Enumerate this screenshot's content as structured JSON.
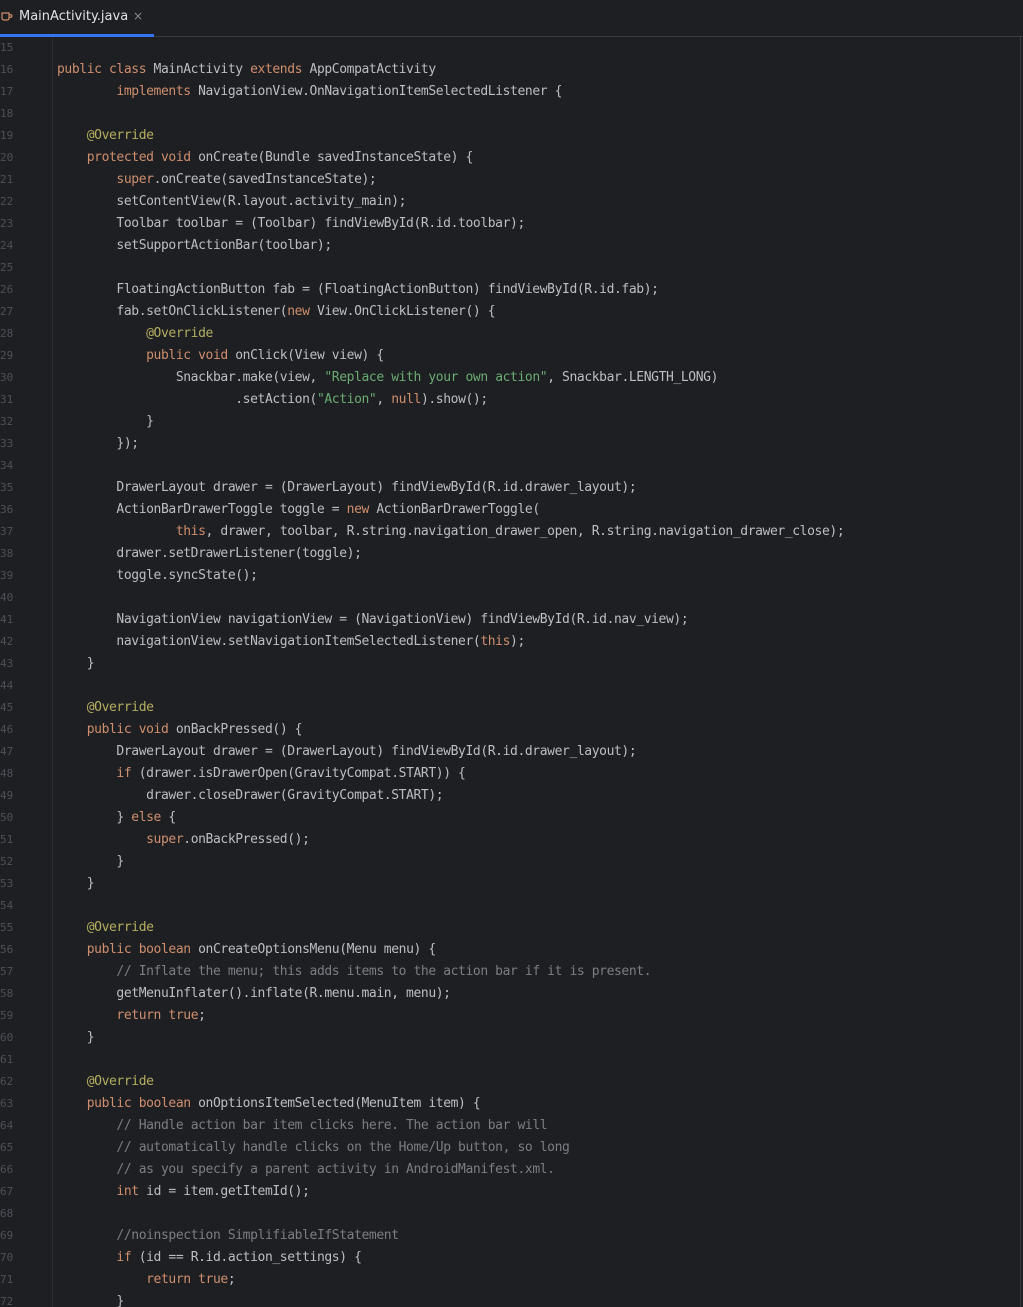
{
  "theme": {
    "background": "#1e1f22",
    "accent": "#3574f0",
    "keyword": "#cf8e6d",
    "annotation": "#b3ae60",
    "string": "#6aab73",
    "comment": "#7a7e85",
    "plain": "#bcbec4",
    "line_number": "#4b5059"
  },
  "tab": {
    "icon": "java-coffee-cup-icon",
    "label": "MainActivity.java",
    "close": "×"
  },
  "lines": [
    {
      "n": "15",
      "tokens": []
    },
    {
      "n": "16",
      "tokens": [
        [
          "kw",
          "public class "
        ],
        [
          "plain",
          "MainActivity "
        ],
        [
          "kw",
          "extends "
        ],
        [
          "plain",
          "AppCompatActivity"
        ]
      ]
    },
    {
      "n": "17",
      "tokens": [
        [
          "plain",
          "        "
        ],
        [
          "kw",
          "implements "
        ],
        [
          "plain",
          "NavigationView.OnNavigationItemSelectedListener {"
        ]
      ]
    },
    {
      "n": "18",
      "tokens": []
    },
    {
      "n": "19",
      "tokens": [
        [
          "plain",
          "    "
        ],
        [
          "ann",
          "@Override"
        ]
      ]
    },
    {
      "n": "20",
      "tokens": [
        [
          "plain",
          "    "
        ],
        [
          "kw",
          "protected void "
        ],
        [
          "plain",
          "onCreate(Bundle savedInstanceState) {"
        ]
      ]
    },
    {
      "n": "21",
      "tokens": [
        [
          "plain",
          "        "
        ],
        [
          "kw",
          "super"
        ],
        [
          "plain",
          ".onCreate(savedInstanceState);"
        ]
      ]
    },
    {
      "n": "22",
      "tokens": [
        [
          "plain",
          "        setContentView(R.layout.activity_main);"
        ]
      ]
    },
    {
      "n": "23",
      "tokens": [
        [
          "plain",
          "        Toolbar toolbar = (Toolbar) findViewById(R.id.toolbar);"
        ]
      ]
    },
    {
      "n": "24",
      "tokens": [
        [
          "plain",
          "        setSupportActionBar(toolbar);"
        ]
      ]
    },
    {
      "n": "25",
      "tokens": []
    },
    {
      "n": "26",
      "tokens": [
        [
          "plain",
          "        FloatingActionButton fab = (FloatingActionButton) findViewById(R.id.fab);"
        ]
      ]
    },
    {
      "n": "27",
      "tokens": [
        [
          "plain",
          "        fab.setOnClickListener("
        ],
        [
          "kw",
          "new "
        ],
        [
          "plain",
          "View.OnClickListener() {"
        ]
      ]
    },
    {
      "n": "28",
      "tokens": [
        [
          "plain",
          "            "
        ],
        [
          "ann",
          "@Override"
        ]
      ]
    },
    {
      "n": "29",
      "tokens": [
        [
          "plain",
          "            "
        ],
        [
          "kw",
          "public void "
        ],
        [
          "plain",
          "onClick(View view) {"
        ]
      ]
    },
    {
      "n": "30",
      "tokens": [
        [
          "plain",
          "                Snackbar.make(view, "
        ],
        [
          "str",
          "\"Replace with your own action\""
        ],
        [
          "plain",
          ", Snackbar.LENGTH_LONG)"
        ]
      ]
    },
    {
      "n": "31",
      "tokens": [
        [
          "plain",
          "                        .setAction("
        ],
        [
          "str",
          "\"Action\""
        ],
        [
          "plain",
          ", "
        ],
        [
          "kw",
          "null"
        ],
        [
          "plain",
          ").show();"
        ]
      ]
    },
    {
      "n": "32",
      "tokens": [
        [
          "plain",
          "            }"
        ]
      ]
    },
    {
      "n": "33",
      "tokens": [
        [
          "plain",
          "        });"
        ]
      ]
    },
    {
      "n": "34",
      "tokens": []
    },
    {
      "n": "35",
      "tokens": [
        [
          "plain",
          "        DrawerLayout drawer = (DrawerLayout) findViewById(R.id.drawer_layout);"
        ]
      ]
    },
    {
      "n": "36",
      "tokens": [
        [
          "plain",
          "        ActionBarDrawerToggle toggle = "
        ],
        [
          "kw",
          "new "
        ],
        [
          "plain",
          "ActionBarDrawerToggle("
        ]
      ]
    },
    {
      "n": "37",
      "tokens": [
        [
          "plain",
          "                "
        ],
        [
          "kw",
          "this"
        ],
        [
          "plain",
          ", drawer, toolbar, R.string.navigation_drawer_open, R.string.navigation_drawer_close);"
        ]
      ]
    },
    {
      "n": "38",
      "tokens": [
        [
          "plain",
          "        drawer.setDrawerListener(toggle);"
        ]
      ]
    },
    {
      "n": "39",
      "tokens": [
        [
          "plain",
          "        toggle.syncState();"
        ]
      ]
    },
    {
      "n": "40",
      "tokens": []
    },
    {
      "n": "41",
      "tokens": [
        [
          "plain",
          "        NavigationView navigationView = (NavigationView) findViewById(R.id.nav_view);"
        ]
      ]
    },
    {
      "n": "42",
      "tokens": [
        [
          "plain",
          "        navigationView.setNavigationItemSelectedListener("
        ],
        [
          "kw",
          "this"
        ],
        [
          "plain",
          ");"
        ]
      ]
    },
    {
      "n": "43",
      "tokens": [
        [
          "plain",
          "    }"
        ]
      ]
    },
    {
      "n": "44",
      "tokens": []
    },
    {
      "n": "45",
      "tokens": [
        [
          "plain",
          "    "
        ],
        [
          "ann",
          "@Override"
        ]
      ]
    },
    {
      "n": "46",
      "tokens": [
        [
          "plain",
          "    "
        ],
        [
          "kw",
          "public void "
        ],
        [
          "plain",
          "onBackPressed() {"
        ]
      ]
    },
    {
      "n": "47",
      "tokens": [
        [
          "plain",
          "        DrawerLayout drawer = (DrawerLayout) findViewById(R.id.drawer_layout);"
        ]
      ]
    },
    {
      "n": "48",
      "tokens": [
        [
          "plain",
          "        "
        ],
        [
          "kw",
          "if "
        ],
        [
          "plain",
          "(drawer.isDrawerOpen(GravityCompat.START)) {"
        ]
      ]
    },
    {
      "n": "49",
      "tokens": [
        [
          "plain",
          "            drawer.closeDrawer(GravityCompat.START);"
        ]
      ]
    },
    {
      "n": "50",
      "tokens": [
        [
          "plain",
          "        } "
        ],
        [
          "kw",
          "else "
        ],
        [
          "plain",
          "{"
        ]
      ]
    },
    {
      "n": "51",
      "tokens": [
        [
          "plain",
          "            "
        ],
        [
          "kw",
          "super"
        ],
        [
          "plain",
          ".onBackPressed();"
        ]
      ]
    },
    {
      "n": "52",
      "tokens": [
        [
          "plain",
          "        }"
        ]
      ]
    },
    {
      "n": "53",
      "tokens": [
        [
          "plain",
          "    }"
        ]
      ]
    },
    {
      "n": "54",
      "tokens": []
    },
    {
      "n": "55",
      "tokens": [
        [
          "plain",
          "    "
        ],
        [
          "ann",
          "@Override"
        ]
      ]
    },
    {
      "n": "56",
      "tokens": [
        [
          "plain",
          "    "
        ],
        [
          "kw",
          "public boolean "
        ],
        [
          "plain",
          "onCreateOptionsMenu(Menu menu) {"
        ]
      ]
    },
    {
      "n": "57",
      "tokens": [
        [
          "plain",
          "        "
        ],
        [
          "cmt",
          "// Inflate the menu; this adds items to the action bar if it is present."
        ]
      ]
    },
    {
      "n": "58",
      "tokens": [
        [
          "plain",
          "        getMenuInflater().inflate(R.menu.main, menu);"
        ]
      ]
    },
    {
      "n": "59",
      "tokens": [
        [
          "plain",
          "        "
        ],
        [
          "kw",
          "return true"
        ],
        [
          "plain",
          ";"
        ]
      ]
    },
    {
      "n": "60",
      "tokens": [
        [
          "plain",
          "    }"
        ]
      ]
    },
    {
      "n": "61",
      "tokens": []
    },
    {
      "n": "62",
      "tokens": [
        [
          "plain",
          "    "
        ],
        [
          "ann",
          "@Override"
        ]
      ]
    },
    {
      "n": "63",
      "tokens": [
        [
          "plain",
          "    "
        ],
        [
          "kw",
          "public boolean "
        ],
        [
          "plain",
          "onOptionsItemSelected(MenuItem item) {"
        ]
      ]
    },
    {
      "n": "64",
      "tokens": [
        [
          "plain",
          "        "
        ],
        [
          "cmt",
          "// Handle action bar item clicks here. The action bar will"
        ]
      ]
    },
    {
      "n": "65",
      "tokens": [
        [
          "plain",
          "        "
        ],
        [
          "cmt",
          "// automatically handle clicks on the Home/Up button, so long"
        ]
      ]
    },
    {
      "n": "66",
      "tokens": [
        [
          "plain",
          "        "
        ],
        [
          "cmt",
          "// as you specify a parent activity in AndroidManifest.xml."
        ]
      ]
    },
    {
      "n": "67",
      "tokens": [
        [
          "plain",
          "        "
        ],
        [
          "kw",
          "int "
        ],
        [
          "plain",
          "id = item.getItemId();"
        ]
      ]
    },
    {
      "n": "68",
      "tokens": []
    },
    {
      "n": "69",
      "tokens": [
        [
          "plain",
          "        "
        ],
        [
          "cmt",
          "//noinspection SimplifiableIfStatement"
        ]
      ]
    },
    {
      "n": "70",
      "tokens": [
        [
          "plain",
          "        "
        ],
        [
          "kw",
          "if "
        ],
        [
          "plain",
          "(id == R.id.action_settings) {"
        ]
      ]
    },
    {
      "n": "71",
      "tokens": [
        [
          "plain",
          "            "
        ],
        [
          "kw",
          "return true"
        ],
        [
          "plain",
          ";"
        ]
      ]
    },
    {
      "n": "72",
      "tokens": [
        [
          "plain",
          "        }"
        ]
      ]
    }
  ]
}
